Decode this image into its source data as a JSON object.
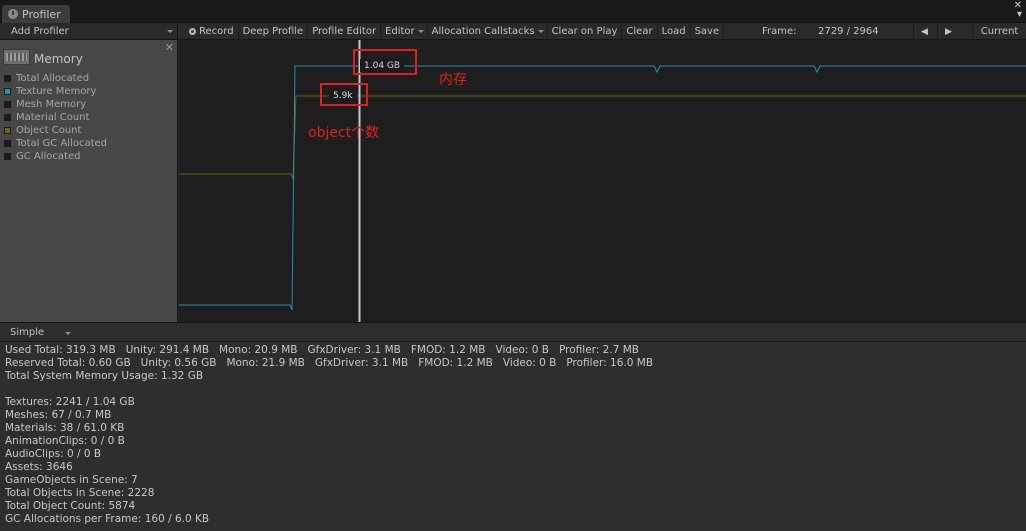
{
  "window": {
    "tab_title": "Profiler",
    "tab_icon": "profiler-icon",
    "controls": [
      "▾",
      "✕"
    ]
  },
  "toolbar": {
    "add_profiler": "Add Profiler",
    "record": "Record",
    "deep_profile": "Deep Profile",
    "profile_editor": "Profile Editor",
    "editor": "Editor",
    "allocation_callstacks": "Allocation Callstacks",
    "clear_on_play": "Clear on Play",
    "clear": "Clear",
    "load": "Load",
    "save": "Save",
    "frame_label": "Frame:",
    "frame_value": "2729 / 2964",
    "prev": "◀",
    "next": "▶",
    "current": "Current"
  },
  "module": {
    "title": "Memory",
    "icon": "memory-chip-icon",
    "close": "✕",
    "legend": [
      {
        "label": "Total Allocated",
        "color": "#1a1a1a"
      },
      {
        "label": "Texture Memory",
        "color": "#2a8fb0"
      },
      {
        "label": "Mesh Memory",
        "color": "#1a1a1a"
      },
      {
        "label": "Material Count",
        "color": "#1a1a1a"
      },
      {
        "label": "Object Count",
        "color": "#6b6416"
      },
      {
        "label": "Total GC Allocated",
        "color": "#1a1a1a"
      },
      {
        "label": "GC Allocated",
        "color": "#1a1a1a"
      }
    ]
  },
  "chart_data": {
    "type": "line",
    "title": "",
    "xlabel": "",
    "ylabel": "",
    "series": [
      {
        "name": "Texture Memory",
        "color": "#2a8fb0",
        "readout": "1.04 GB"
      },
      {
        "name": "Object Count",
        "color": "#6b6416",
        "readout": "5.9k"
      }
    ],
    "selected_frame": "2729"
  },
  "annotations": {
    "memory_note": "内存",
    "object_note": "object个数",
    "color": "#e02020"
  },
  "view_mode": "Simple",
  "details": [
    "Used Total: 319.3 MB   Unity: 291.4 MB   Mono: 20.9 MB   GfxDriver: 3.1 MB   FMOD: 1.2 MB   Video: 0 B   Profiler: 2.7 MB",
    "Reserved Total: 0.60 GB   Unity: 0.56 GB   Mono: 21.9 MB   GfxDriver: 3.1 MB   FMOD: 1.2 MB   Video: 0 B   Profiler: 16.0 MB",
    "Total System Memory Usage: 1.32 GB",
    "",
    "Textures: 2241 / 1.04 GB",
    "Meshes: 67 / 0.7 MB",
    "Materials: 38 / 61.0 KB",
    "AnimationClips: 0 / 0 B",
    "AudioClips: 0 / 0 B",
    "Assets: 3646",
    "GameObjects in Scene: 7",
    "Total Objects in Scene: 2228",
    "Total Object Count: 5874",
    "GC Allocations per Frame: 160 / 6.0 KB"
  ]
}
